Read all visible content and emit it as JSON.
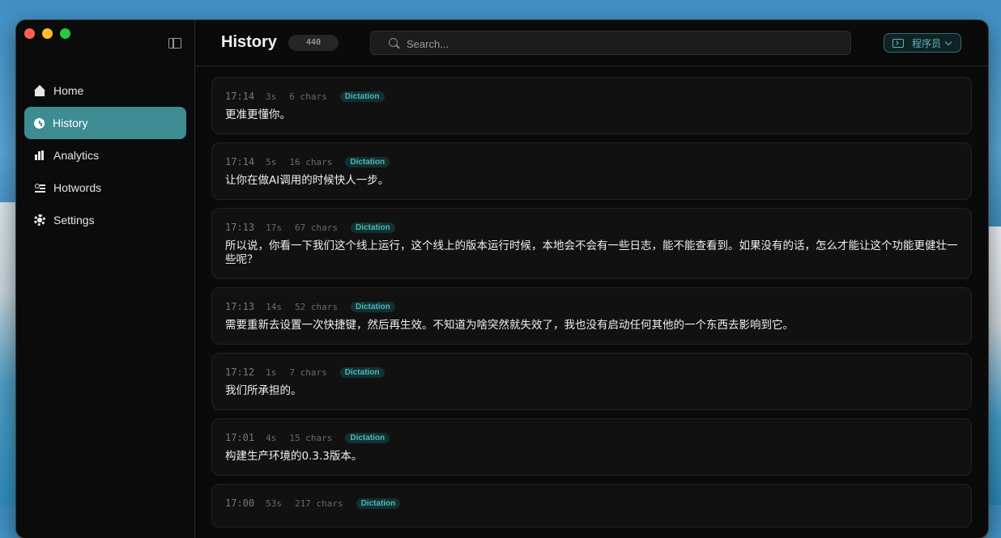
{
  "sidebar": {
    "items": [
      {
        "label": "Home",
        "icon": "home-icon",
        "active": false
      },
      {
        "label": "History",
        "icon": "clock-icon",
        "active": true
      },
      {
        "label": "Analytics",
        "icon": "bar-chart-icon",
        "active": false
      },
      {
        "label": "Hotwords",
        "icon": "list-icon",
        "active": false
      },
      {
        "label": "Settings",
        "icon": "gear-icon",
        "active": false
      }
    ]
  },
  "header": {
    "title": "History",
    "count": "440",
    "search_placeholder": "Search...",
    "mode_label": "程序员"
  },
  "entries": [
    {
      "time": "17:14",
      "duration": "3s",
      "chars": "6 chars",
      "tag": "Dictation",
      "text": "更准更懂你。"
    },
    {
      "time": "17:14",
      "duration": "5s",
      "chars": "16 chars",
      "tag": "Dictation",
      "text": "让你在做AI调用的时候快人一步。"
    },
    {
      "time": "17:13",
      "duration": "17s",
      "chars": "67 chars",
      "tag": "Dictation",
      "text": "所以说，你看一下我们这个线上运行，这个线上的版本运行时候，本地会不会有一些日志，能不能查看到。如果没有的话，怎么才能让这个功能更健壮一些呢？"
    },
    {
      "time": "17:13",
      "duration": "14s",
      "chars": "52 chars",
      "tag": "Dictation",
      "text": "需要重新去设置一次快捷键，然后再生效。不知道为啥突然就失效了，我也没有启动任何其他的一个东西去影响到它。"
    },
    {
      "time": "17:12",
      "duration": "1s",
      "chars": "7 chars",
      "tag": "Dictation",
      "text": "我们所承担的。"
    },
    {
      "time": "17:01",
      "duration": "4s",
      "chars": "15 chars",
      "tag": "Dictation",
      "text": "构建生产环境的0.3.3版本。"
    },
    {
      "time": "17:00",
      "duration": "53s",
      "chars": "217 chars",
      "tag": "Dictation",
      "text": ""
    }
  ],
  "colors": {
    "accent": "#3e8b93",
    "tag_text": "#52b6bf",
    "background": "#0a0a0a"
  }
}
